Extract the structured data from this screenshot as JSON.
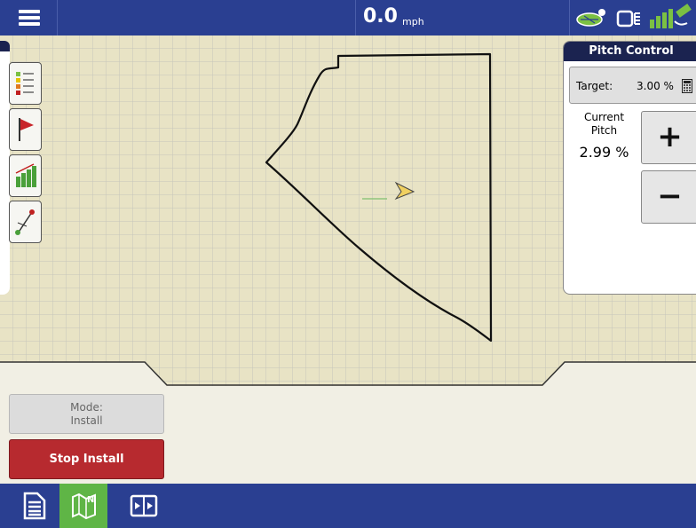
{
  "topbar": {
    "menu_icon": "hamburger-menu-icon",
    "speed_value": "0.0",
    "speed_unit": "mph",
    "status_icons": [
      "field-zone-icon",
      "display-status-icon",
      "gps-satellite-icon"
    ]
  },
  "map": {
    "background_color": "#e8e3c5",
    "grid_color": "#c6c6ba",
    "boundary_color": "#111111",
    "vehicle_color": "#f0d060",
    "trail_color": "#7fc06f"
  },
  "left_toolbar": {
    "buttons": [
      {
        "icon": "legend-icon"
      },
      {
        "icon": "flag-icon"
      },
      {
        "icon": "bar-chart-icon"
      },
      {
        "icon": "guidance-line-icon"
      }
    ]
  },
  "pitch_control": {
    "title": "Pitch Control",
    "target_label": "Target:",
    "target_value": "3.00 %",
    "target_icon": "calculator-icon",
    "current_label_line1": "Current",
    "current_label_line2": "Pitch",
    "current_value": "2.99 %",
    "increase_label": "+",
    "decrease_label": "−"
  },
  "controls": {
    "mode_label": "Mode:",
    "mode_value": "Install",
    "stop_label": "Stop Install",
    "stop_color": "#b72a2f"
  },
  "bottom_tabs": [
    {
      "icon": "summary-document-icon",
      "active": false
    },
    {
      "icon": "map-view-icon",
      "active": true
    },
    {
      "icon": "split-screen-icon",
      "active": false
    }
  ],
  "colors": {
    "bar_blue": "#2a3f91",
    "panel_header": "#1b2350",
    "active_tab": "#5fb546"
  }
}
